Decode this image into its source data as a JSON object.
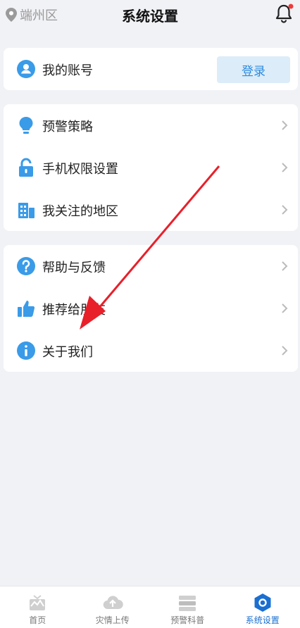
{
  "header": {
    "location": "端州区",
    "title": "系统设置"
  },
  "account": {
    "label": "我的账号",
    "login_label": "登录"
  },
  "group1": [
    {
      "label": "预警策略",
      "icon": "lightbulb-icon"
    },
    {
      "label": "手机权限设置",
      "icon": "lock-icon"
    },
    {
      "label": "我关注的地区",
      "icon": "building-icon"
    }
  ],
  "group2": [
    {
      "label": "帮助与反馈",
      "icon": "question-icon"
    },
    {
      "label": "推荐给朋友",
      "icon": "thumbs-up-icon"
    },
    {
      "label": "关于我们",
      "icon": "info-icon"
    }
  ],
  "tabs": [
    {
      "label": "首页",
      "icon": "home-icon"
    },
    {
      "label": "灾情上传",
      "icon": "cloud-upload-icon"
    },
    {
      "label": "预警科普",
      "icon": "stack-icon"
    },
    {
      "label": "系统设置",
      "icon": "settings-hex-icon",
      "active": true
    }
  ],
  "colors": {
    "accent": "#3a9be8",
    "background": "#f1f2f6",
    "arrow": "#e8202a"
  }
}
